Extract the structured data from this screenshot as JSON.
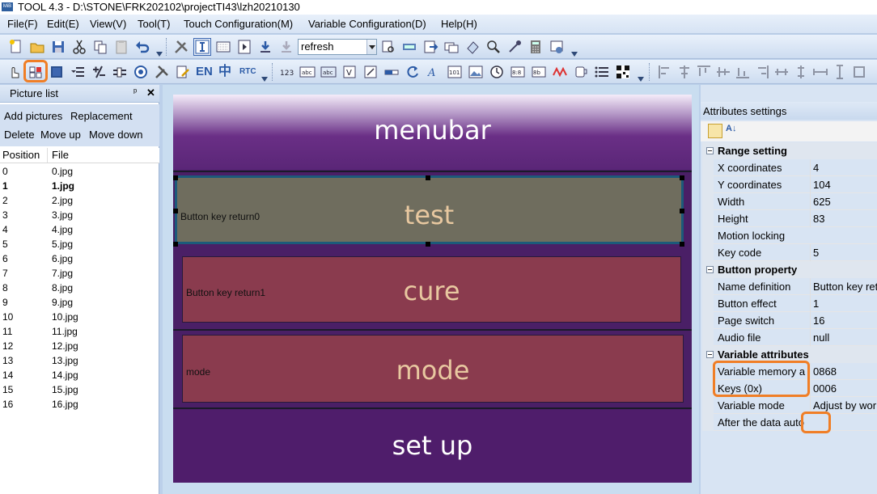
{
  "window": {
    "title": "TOOL 4.3 - D:\\STONE\\FRK202102\\projectTI43\\lzh20210130",
    "icon_text": "MiB"
  },
  "menu": [
    "File(F)",
    "Edit(E)",
    "View(V)",
    "Tool(T)",
    "Touch Configuration(M)",
    "Variable Configuration(D)",
    "Help(H)"
  ],
  "toolbar": {
    "combo_value": "refresh",
    "text_tools": {
      "en": "EN",
      "zh": "中",
      "rtc": "RTC"
    }
  },
  "picture_list": {
    "title": "Picture list",
    "actions": [
      "Add pictures",
      "Replacement",
      "Delete",
      "Move up",
      "Move down"
    ],
    "columns": [
      "Position",
      "File"
    ],
    "rows": [
      {
        "pos": "0",
        "file": "0.jpg"
      },
      {
        "pos": "1",
        "file": "1.jpg"
      },
      {
        "pos": "2",
        "file": "2.jpg"
      },
      {
        "pos": "3",
        "file": "3.jpg"
      },
      {
        "pos": "4",
        "file": "4.jpg"
      },
      {
        "pos": "5",
        "file": "5.jpg"
      },
      {
        "pos": "6",
        "file": "6.jpg"
      },
      {
        "pos": "7",
        "file": "7.jpg"
      },
      {
        "pos": "8",
        "file": "8.jpg"
      },
      {
        "pos": "9",
        "file": "9.jpg"
      },
      {
        "pos": "10",
        "file": "10.jpg"
      },
      {
        "pos": "11",
        "file": "11.jpg"
      },
      {
        "pos": "12",
        "file": "12.jpg"
      },
      {
        "pos": "13",
        "file": "13.jpg"
      },
      {
        "pos": "14",
        "file": "14.jpg"
      },
      {
        "pos": "15",
        "file": "15.jpg"
      },
      {
        "pos": "16",
        "file": "16.jpg"
      }
    ],
    "selected_index": 1
  },
  "canvas": {
    "menubar": "menubar",
    "buttons": [
      {
        "label": "Button key return0",
        "text": "test"
      },
      {
        "label": "Button key return1",
        "text": "cure"
      },
      {
        "label": "mode",
        "text": "mode"
      }
    ],
    "setup": "set up"
  },
  "attributes": {
    "title": "Attributes settings",
    "range_setting": "Range setting",
    "x_label": "X coordinates",
    "x_value": "4",
    "y_label": "Y coordinates",
    "y_value": "104",
    "w_label": "Width",
    "w_value": "625",
    "h_label": "Height",
    "h_value": "83",
    "lock_label": "Motion locking",
    "lock_checked": false,
    "key_label": "Key code",
    "key_value": "5",
    "button_property": "Button property",
    "name_label": "Name definition",
    "name_value": "Button key ret",
    "effect_label": "Button effect",
    "effect_value": "1",
    "page_label": "Page switch",
    "page_value": "16",
    "audio_label": "Audio file",
    "audio_value": "null",
    "variable_attributes": "Variable attributes",
    "mem_label": "Variable memory a",
    "mem_value": "0868",
    "keys_label": "Keys (0x)",
    "keys_value": "0006",
    "mode_label": "Variable mode",
    "mode_value": "Adjust by wor",
    "auto_label": "After the data auto",
    "auto_checked": true
  }
}
